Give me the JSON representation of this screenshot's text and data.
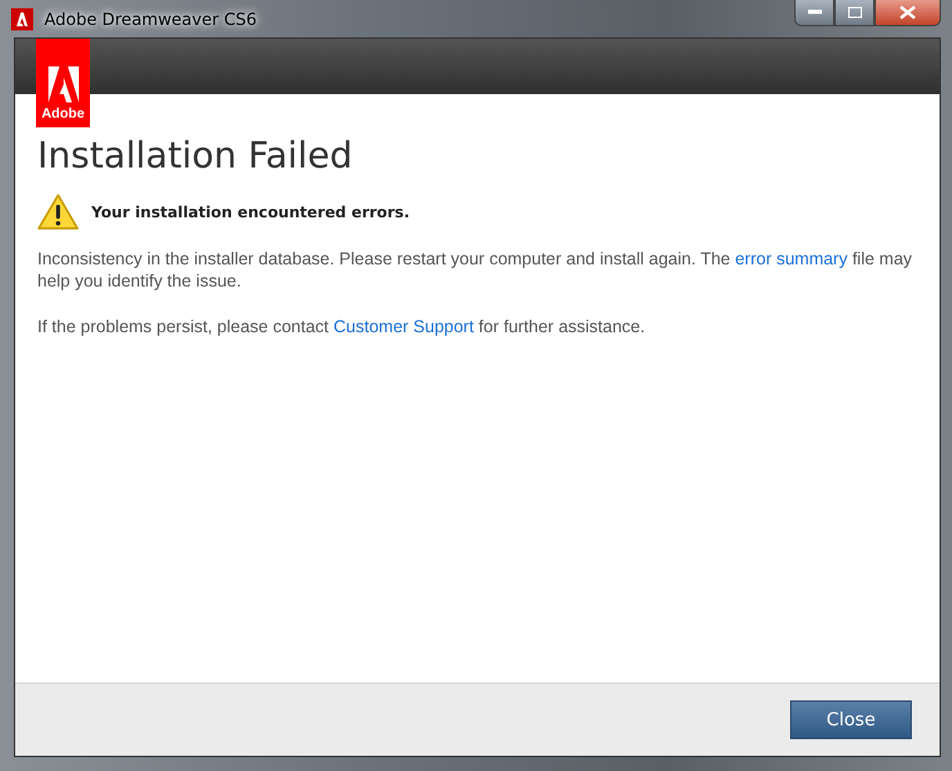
{
  "window": {
    "title": "Adobe Dreamweaver CS6"
  },
  "logo": {
    "text": "Adobe"
  },
  "heading": "Installation Failed",
  "alert": {
    "kind": "warning",
    "message": "Your installation encountered errors."
  },
  "paragraphs": [
    {
      "parts": [
        {
          "kind": "text",
          "text": "Inconsistency in the installer database. Please restart your computer and install again. The "
        },
        {
          "kind": "link",
          "text": "error summary"
        },
        {
          "kind": "text",
          "text": " file may help you identify the issue."
        }
      ]
    },
    {
      "parts": [
        {
          "kind": "text",
          "text": "If the problems persist, please contact "
        },
        {
          "kind": "link",
          "text": "Customer Support"
        },
        {
          "kind": "text",
          "text": " for further assistance."
        }
      ]
    }
  ],
  "buttons": [
    "Close"
  ]
}
